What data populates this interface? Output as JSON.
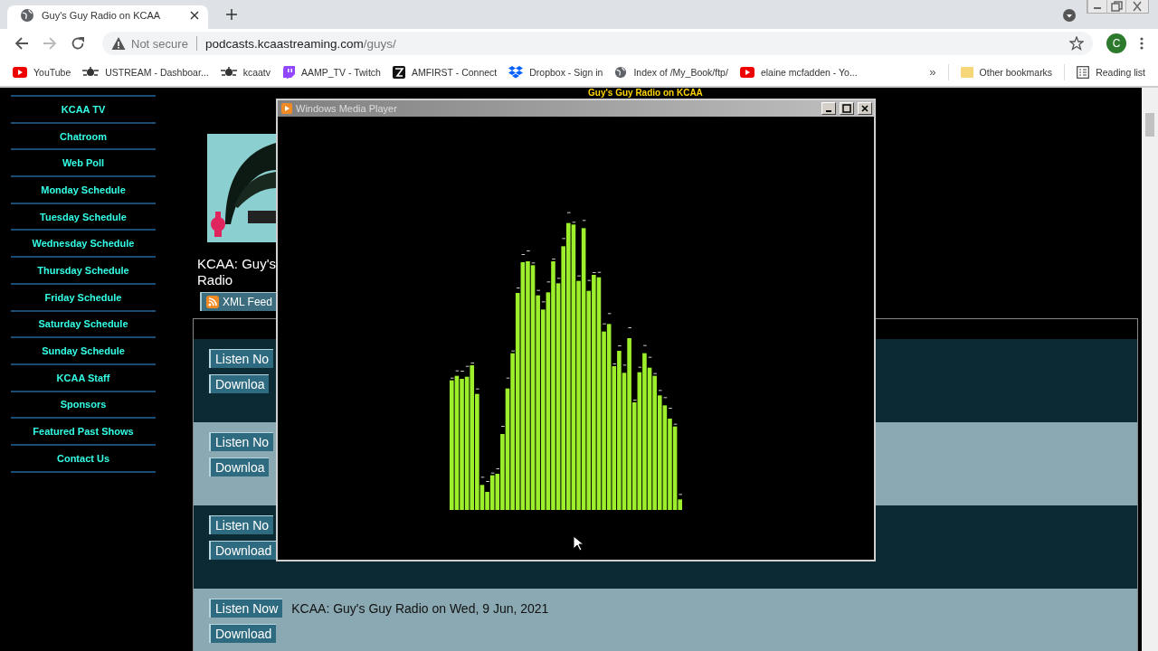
{
  "browser": {
    "tab": {
      "title": "Guy's Guy Radio on KCAA",
      "selected": true
    },
    "address": {
      "security": "Not secure",
      "host": "podcasts.kcaastreaming.com",
      "path": "/guys/"
    },
    "avatar": "C",
    "bookmarks": [
      {
        "kind": "youtube",
        "label": "YouTube"
      },
      {
        "kind": "ustream",
        "label": "USTREAM - Dashboar..."
      },
      {
        "kind": "ustream",
        "label": "kcaatv"
      },
      {
        "kind": "twitch",
        "label": "AAMP_TV - Twitch"
      },
      {
        "kind": "amfirst",
        "label": "AMFIRST - Connect"
      },
      {
        "kind": "dropbox",
        "label": "Dropbox - Sign in"
      },
      {
        "kind": "globe",
        "label": "Index of /My_Book/ftp/"
      },
      {
        "kind": "youtube",
        "label": "elaine mcfadden - Yo..."
      }
    ],
    "more": "»",
    "other_bookmarks": "Other bookmarks",
    "reading_list": "Reading list"
  },
  "page": {
    "heading": "Guy's Guy Radio on KCAA",
    "sidebar": {
      "items": [
        "KCAA TV",
        "Chatroom",
        "Web Poll",
        "Monday Schedule",
        "Tuesday Schedule",
        "Wednesday Schedule",
        "Thursday Schedule",
        "Friday Schedule",
        "Saturday Schedule",
        "Sunday Schedule",
        "KCAA Staff",
        "Sponsors",
        "Featured Past Shows",
        "Contact Us"
      ]
    },
    "podcast": {
      "title_lines": [
        "KCAA: Guy's",
        "Radio"
      ],
      "feed_button": "XML Feed"
    },
    "episodes": [
      {
        "kind": "dark",
        "listen": "Listen No",
        "download": "Downloa"
      },
      {
        "kind": "light",
        "listen": "Listen No",
        "download": "Downloa"
      },
      {
        "kind": "dark",
        "listen": "Listen No",
        "download": "Download"
      },
      {
        "kind": "light",
        "listen": "Listen Now",
        "download": "Download",
        "title": "KCAA: Guy's Guy Radio on Wed, 9 Jun, 2021"
      }
    ]
  },
  "media_player": {
    "title": "Windows Media Player"
  }
}
